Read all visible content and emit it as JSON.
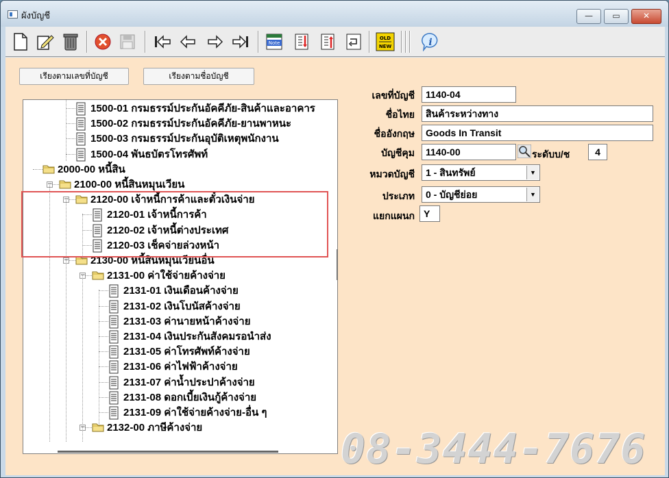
{
  "window": {
    "title": "ผังบัญชี",
    "min": "—",
    "max": "▭",
    "close": "✕"
  },
  "toolbar": {
    "buttons": [
      "new-icon",
      "edit-icon",
      "delete-icon",
      "cancel-icon",
      "save-icon",
      "first-icon",
      "prev-icon",
      "next-icon",
      "last-icon",
      "note-icon",
      "import-icon",
      "export-icon",
      "undo-icon",
      "old-new-icon",
      "info-icon"
    ],
    "note_label": "Note",
    "old_label": "OLD",
    "new_label": "NEW"
  },
  "sort": {
    "by_number": "เรียงตามเลขที่บัญชี",
    "by_name": "เรียงตามชื่อบัญชี"
  },
  "tree": {
    "nodes": [
      {
        "label": "1500-01 กรมธรรม์ประกันอัคคีภัย-สินค้าและอาคาร",
        "type": "doc",
        "level": 2
      },
      {
        "label": "1500-02 กรมธรรม์ประกันอัคคีภัย-ยานพาหนะ",
        "type": "doc",
        "level": 2
      },
      {
        "label": "1500-03 กรมธรรม์ประกันอุบัติเหตุพนักงาน",
        "type": "doc",
        "level": 2
      },
      {
        "label": "1500-04 พันธบัตรโทรศัพท์",
        "type": "doc",
        "level": 2
      },
      {
        "label": "2000-00 หนี้สิน",
        "type": "folder",
        "level": 0
      },
      {
        "label": "2100-00 หนี้สินหมุนเวียน",
        "type": "folder",
        "level": 1
      },
      {
        "label": "2120-00 เจ้าหนี้การค้าและตั๋วเงินจ่าย",
        "type": "folder",
        "level": 2
      },
      {
        "label": "2120-01 เจ้าหนี้การค้า",
        "type": "doc",
        "level": 3
      },
      {
        "label": "2120-02 เจ้าหนี้ต่างประเทศ",
        "type": "doc",
        "level": 3
      },
      {
        "label": "2120-03 เช็คจ่ายล่วงหน้า",
        "type": "doc",
        "level": 3
      },
      {
        "label": "2130-00 หนี้สินหมุนเวียนอื่น",
        "type": "folder",
        "level": 2
      },
      {
        "label": "2131-00 ค่าใช้จ่ายค้างจ่าย",
        "type": "folder",
        "level": 3
      },
      {
        "label": "2131-01 เงินเดือนค้างจ่าย",
        "type": "doc",
        "level": 4
      },
      {
        "label": "2131-02 เงินโบนัสค้างจ่าย",
        "type": "doc",
        "level": 4
      },
      {
        "label": "2131-03 ค่านายหน้าค้างจ่าย",
        "type": "doc",
        "level": 4
      },
      {
        "label": "2131-04 เงินประกันสังคมรอนำส่ง",
        "type": "doc",
        "level": 4
      },
      {
        "label": "2131-05 ค่าโทรศัพท์ค้างจ่าย",
        "type": "doc",
        "level": 4
      },
      {
        "label": "2131-06 ค่าไฟฟ้าค้างจ่าย",
        "type": "doc",
        "level": 4
      },
      {
        "label": "2131-07 ค่าน้ำประปาค้างจ่าย",
        "type": "doc",
        "level": 4
      },
      {
        "label": "2131-08 ดอกเบี้ยเงินกู้ค้างจ่าย",
        "type": "doc",
        "level": 4
      },
      {
        "label": "2131-09 ค่าใช้จ่ายค้างจ่าย-อื่น ๆ",
        "type": "doc",
        "level": 4
      },
      {
        "label": "2132-00 ภาษีค้างจ่าย",
        "type": "folder",
        "level": 3
      }
    ]
  },
  "form": {
    "account_no_label": "เลขที่บัญชี",
    "account_no": "1140-04",
    "thai_name_label": "ชื่อไทย",
    "thai_name": "สินค้าระหว่างทาง",
    "english_name_label": "ชื่ออังกฤษ",
    "english_name": "Goods In Transit",
    "control_account_label": "บัญชีคุม",
    "control_account": "1140-00",
    "level_label": "ระดับบ/ช",
    "level": "4",
    "category_label": "หมวดบัญชี",
    "category": "1 - สินทรัพย์",
    "type_label": "ประเภท",
    "type": "0 - บัญชีย่อย",
    "department_label": "แยกแผนก",
    "department": "Y"
  },
  "watermark": "08-3444-7676",
  "colors": {
    "content_bg": "#fde4c7",
    "highlight": "#e05353",
    "title_bg": "#c3d4e4"
  }
}
